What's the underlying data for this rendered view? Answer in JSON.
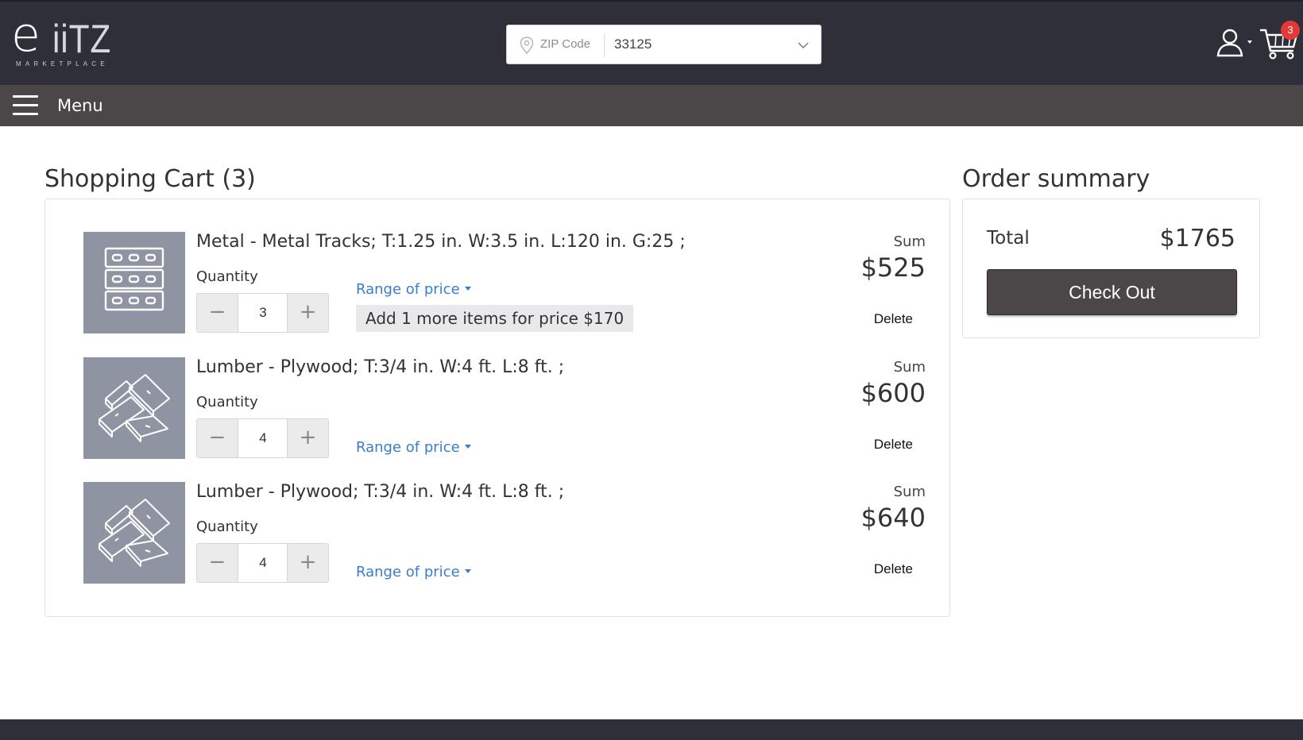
{
  "header": {
    "logo_main": "e",
    "logo_rest": "iiTZ",
    "logo_sub": "MARKETPLACE",
    "zip_label": "ZIP Code",
    "zip_value": "33125",
    "cart_count": "3",
    "background": "#2e2f38"
  },
  "menubar": {
    "label": "Menu",
    "background": "#4b4648"
  },
  "cart": {
    "title": "Shopping Cart (3)",
    "items": [
      {
        "title": "Metal - Metal Tracks; T:1.25 in. W:3.5 in. L:120 in. G:25 ;",
        "quantity_label": "Quantity",
        "quantity": "3",
        "range_label": "Range of price",
        "promo": "Add 1 more items for price $170",
        "sum_label": "Sum",
        "sum": "$525",
        "delete_label": "Delete",
        "icon": "metal-tracks-icon"
      },
      {
        "title": "Lumber - Plywood; T:3/4 in. W:4 ft. L:8 ft. ;",
        "quantity_label": "Quantity",
        "quantity": "4",
        "range_label": "Range of price",
        "sum_label": "Sum",
        "sum": "$600",
        "delete_label": "Delete",
        "icon": "plywood-icon"
      },
      {
        "title": "Lumber - Plywood; T:3/4 in. W:4 ft. L:8 ft. ;",
        "quantity_label": "Quantity",
        "quantity": "4",
        "range_label": "Range of price",
        "sum_label": "Sum",
        "sum": "$640",
        "delete_label": "Delete",
        "icon": "plywood-icon"
      }
    ]
  },
  "summary": {
    "title": "Order summary",
    "total_label": "Total",
    "total_value": "$1765",
    "checkout_label": "Check Out"
  },
  "colors": {
    "link": "#3a7dc9",
    "badge": "#e53838",
    "thumb": "#8e94a2"
  }
}
